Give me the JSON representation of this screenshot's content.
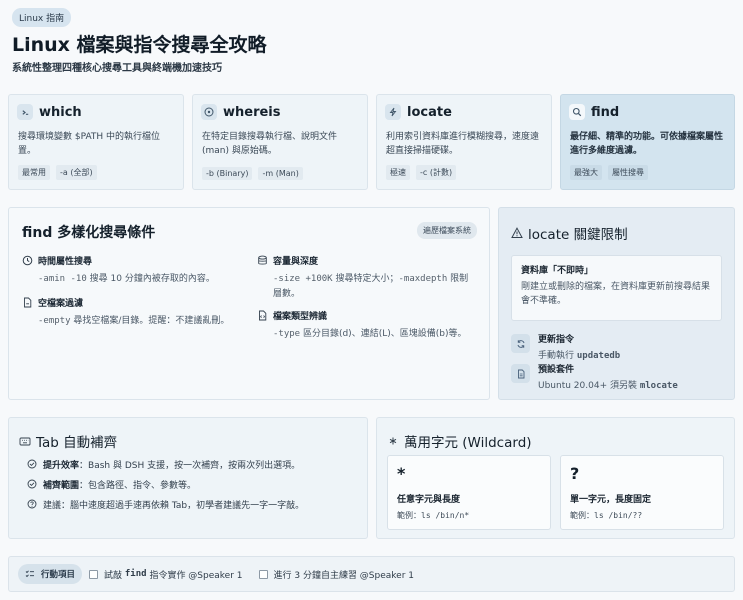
{
  "header": {
    "badge": "Linux 指南",
    "title": "Linux 檔案與指令搜尋全攻略",
    "subtitle": "系統性整理四種核心搜尋工具與終端機加速技巧"
  },
  "tools": [
    {
      "icon": "terminal-icon",
      "name": "which",
      "desc": "搜尋環境變數 $PATH 中的執行檔位置。",
      "tags": [
        "最常用",
        "-a (全部)"
      ]
    },
    {
      "icon": "info-icon",
      "name": "whereis",
      "desc": "在特定目錄搜尋執行檔、說明文件 (man) 與原始碼。",
      "tags": [
        "-b (Binary)",
        "-m (Man)"
      ]
    },
    {
      "icon": "lightning-icon",
      "name": "locate",
      "desc": "利用索引資料庫進行模糊搜尋，速度遠超直接掃描硬碟。",
      "tags": [
        "極速",
        "-c (計數)"
      ]
    },
    {
      "icon": "search-icon",
      "name": "find",
      "desc": "最仔細、精準的功能。可依據檔案屬性進行多維度過濾。",
      "tags": [
        "最強大",
        "屬性搜尋"
      ]
    }
  ],
  "find_conditions": {
    "title": "find 多樣化搜尋條件",
    "badge": "遍歷檔案系統",
    "items": [
      {
        "icon": "clock-icon",
        "title": "時間屬性搜尋",
        "code": "-amin -10",
        "desc": " 搜尋 10 分鐘內被存取的內容。"
      },
      {
        "icon": "database-icon",
        "title": "容量與深度",
        "code": "-size +100K",
        "desc": " 搜尋特定大小；",
        "code2": "-maxdepth",
        "desc2": " 限制層數。"
      },
      {
        "icon": "empty-file-icon",
        "title": "空檔案過濾",
        "code": "-empty",
        "desc": " 尋找空檔案/目錄。提醒：不建議亂刪。"
      },
      {
        "icon": "file-type-icon",
        "title": "檔案類型辨識",
        "code": "-type",
        "desc": " 區分目錄(d)、連結(L)、區塊設備(b)等。"
      }
    ]
  },
  "locate_limits": {
    "title": "locate 關鍵限制",
    "box_title": "資料庫「不即時」",
    "box_desc": "剛建立或刪除的檔案，在資料庫更新前搜尋結果會不準確。",
    "rows": [
      {
        "icon": "refresh-icon",
        "title": "更新指令",
        "desc": "手動執行 ",
        "code": "updatedb"
      },
      {
        "icon": "package-icon",
        "title": "預設套件",
        "desc": "Ubuntu 20.04+ 須另裝 ",
        "code": "mlocate"
      }
    ]
  },
  "tab_completion": {
    "title": "Tab 自動補齊",
    "items": [
      {
        "icon": "check-circle-icon",
        "label": "提升效率",
        "text": "：Bash 與 DSH 支援，按一次補齊，按兩次列出選項。"
      },
      {
        "icon": "check-circle-icon",
        "label": "補齊範圍",
        "text": "：包含路徑、指令、參數等。"
      },
      {
        "icon": "help-circle-icon",
        "label": "",
        "text": "建議：腦中速度超過手速再依賴 Tab，初學者建議先一字一字敲。"
      }
    ]
  },
  "wildcard": {
    "title": "萬用字元 (Wildcard)",
    "title_icon": "asterisk-icon",
    "boxes": [
      {
        "symbol": "*",
        "title": "任意字元與長度",
        "example_label": "範例：",
        "example_code": "ls /bin/n*"
      },
      {
        "symbol": "?",
        "title": "單一字元，長度固定",
        "example_label": "範例：",
        "example_code": "ls /bin/??"
      }
    ]
  },
  "actions": {
    "badge": "行動項目",
    "items": [
      {
        "prefix": "試敲 ",
        "code": "find",
        "suffix": " 指令實作 @Speaker 1"
      },
      {
        "prefix": "進行 3 分鐘自主練習 @Speaker 1",
        "code": "",
        "suffix": ""
      }
    ]
  }
}
